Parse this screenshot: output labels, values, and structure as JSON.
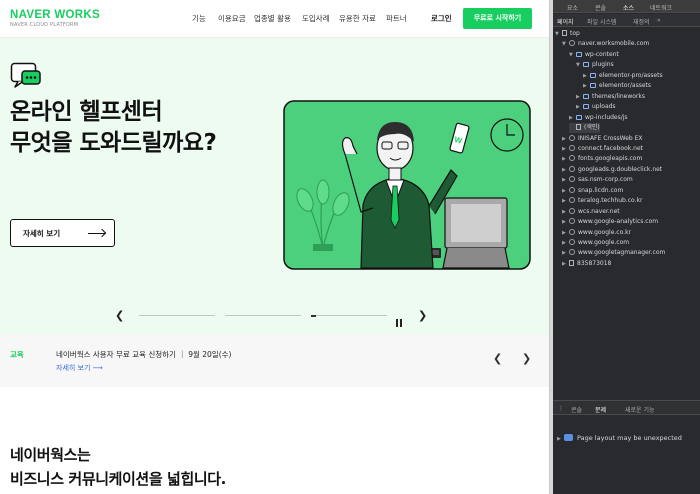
{
  "nav": {
    "logo_main": "NAVER WORKS",
    "logo_sub": "NAVER CLOUD PLATFORM",
    "menu": [
      "기능",
      "이용요금",
      "업종별 활용",
      "도입사례",
      "유용한 자료",
      "파트너"
    ],
    "login": "로그인",
    "cta": "무료로 시작하기"
  },
  "hero": {
    "title_line1": "온라인 헬프센터",
    "title_line2": "무엇을 도와드릴까요?",
    "detail_button": "자세히 보기",
    "carousel_active_index": 2,
    "carousel_slide_count": 3
  },
  "notice": {
    "label": "교육",
    "text": "네이버웍스 사용자 무료 교육 신청하기 ｜ 9월 20일(수)",
    "link": "자세히 보기 ⟶"
  },
  "bottom": {
    "title_line1": "네이버웍스는",
    "title_line2": "비즈니스 커뮤니케이션을 넓힙니다."
  },
  "devtools": {
    "top_tabs": [
      "요소",
      "콘솔",
      "소스",
      "네트워크"
    ],
    "sub_tabs": [
      "페이지",
      "파일 시스템",
      "재정의",
      "»"
    ],
    "tree": [
      {
        "depth": 0,
        "arrow": "▼",
        "icon": "page",
        "label": "top"
      },
      {
        "depth": 1,
        "arrow": "▼",
        "icon": "cloud",
        "label": "naver.worksmobile.com"
      },
      {
        "depth": 2,
        "arrow": "▼",
        "icon": "folder",
        "label": "wp-content"
      },
      {
        "depth": 3,
        "arrow": "▼",
        "icon": "folder",
        "label": "plugins"
      },
      {
        "depth": 4,
        "arrow": "▶",
        "icon": "folder",
        "label": "elementor-pro/assets"
      },
      {
        "depth": 4,
        "arrow": "▶",
        "icon": "folder",
        "label": "elementor/assets"
      },
      {
        "depth": 3,
        "arrow": "▶",
        "icon": "folder",
        "label": "themes/lineworks"
      },
      {
        "depth": 3,
        "arrow": "▶",
        "icon": "folder",
        "label": "uploads"
      },
      {
        "depth": 2,
        "arrow": "▶",
        "icon": "folder",
        "label": "wp-includes/js"
      },
      {
        "depth": 2,
        "arrow": "",
        "icon": "file",
        "label": "(색인)"
      },
      {
        "depth": 1,
        "arrow": "▶",
        "icon": "cloud",
        "label": "INISAFE CrossWeb EX"
      },
      {
        "depth": 1,
        "arrow": "▶",
        "icon": "cloud",
        "label": "connect.facebook.net"
      },
      {
        "depth": 1,
        "arrow": "▶",
        "icon": "cloud",
        "label": "fonts.googleapis.com"
      },
      {
        "depth": 1,
        "arrow": "▶",
        "icon": "cloud",
        "label": "googleads.g.doubleclick.net"
      },
      {
        "depth": 1,
        "arrow": "▶",
        "icon": "cloud",
        "label": "sas.nsm-corp.com"
      },
      {
        "depth": 1,
        "arrow": "▶",
        "icon": "cloud",
        "label": "snap.licdn.com"
      },
      {
        "depth": 1,
        "arrow": "▶",
        "icon": "cloud",
        "label": "teralog.techhub.co.kr"
      },
      {
        "depth": 1,
        "arrow": "▶",
        "icon": "cloud",
        "label": "wcs.naver.net"
      },
      {
        "depth": 1,
        "arrow": "▶",
        "icon": "cloud",
        "label": "www.google-analytics.com"
      },
      {
        "depth": 1,
        "arrow": "▶",
        "icon": "cloud",
        "label": "www.google.co.kr"
      },
      {
        "depth": 1,
        "arrow": "▶",
        "icon": "cloud",
        "label": "www.google.com"
      },
      {
        "depth": 1,
        "arrow": "▶",
        "icon": "cloud",
        "label": "www.googletagmanager.com"
      },
      {
        "depth": 1,
        "arrow": "▶",
        "icon": "page",
        "label": "835873018"
      }
    ],
    "drawer_tabs": [
      "⋮",
      "콘솔",
      "문제",
      "새로운 기능"
    ],
    "drawer_active_tab": "문제",
    "issue_arrow": "▶",
    "issue_text": "Page layout may be unexpected"
  },
  "colors": {
    "brand": "#19ce60",
    "hero_bg": "#eefbf0",
    "illustration_bg": "#4cd07d",
    "devtools_bg": "#292a2d"
  }
}
